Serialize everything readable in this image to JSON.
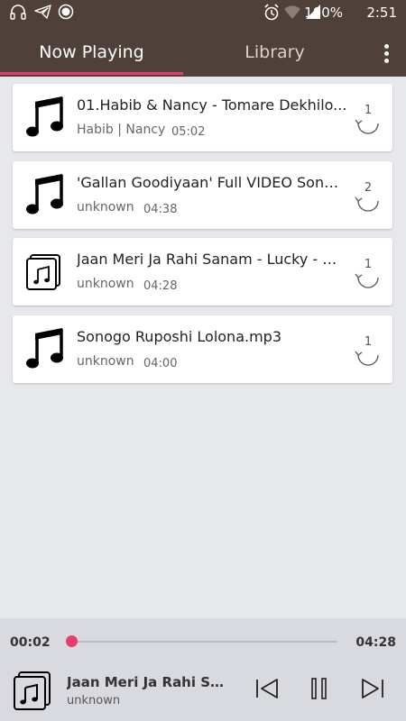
{
  "status": {
    "battery": "100%",
    "time": "2:51"
  },
  "tabs": [
    {
      "label": "Now Playing"
    },
    {
      "label": "Library"
    }
  ],
  "songs": [
    {
      "title": "01.Habib & Nancy - Tomare Dekhilo...",
      "artist": "Habib | Nancy",
      "duration": "05:02",
      "count": "1",
      "icon": "music-note-icon"
    },
    {
      "title": "'Gallan Goodiyaan' Full VIDEO Song -..",
      "artist": "unknown",
      "duration": "04:38",
      "count": "2",
      "icon": "music-note-icon"
    },
    {
      "title": "Jaan Meri Ja Rahi Sanam - Lucky - No T..",
      "artist": "unknown",
      "duration": "04:28",
      "count": "1",
      "icon": "album-icon"
    },
    {
      "title": "Sonogo Ruposhi Lolona.mp3",
      "artist": "unknown",
      "duration": "04:00",
      "count": "1",
      "icon": "music-note-icon"
    }
  ],
  "player": {
    "position": "00:02",
    "total": "04:28",
    "progress": 0.0075,
    "title": "Jaan Meri Ja Rahi Sana...",
    "artist": "unknown"
  },
  "colors": {
    "appbar": "#4f4039",
    "accent": "#e93b73",
    "background": "#e6e8ec"
  }
}
